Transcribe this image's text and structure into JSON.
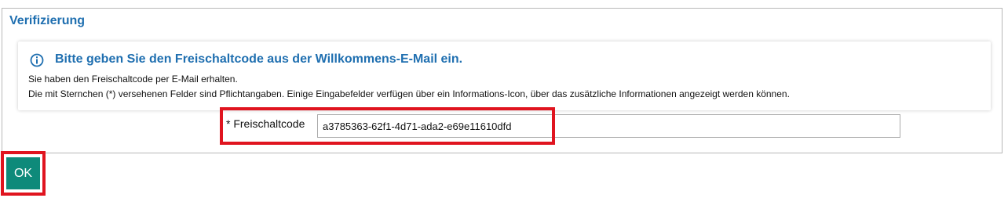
{
  "panel": {
    "title": "Verifizierung"
  },
  "info": {
    "icon": "info-circle-icon",
    "heading": "Bitte geben Sie den Freischaltcode aus der Willkommens-E-Mail ein.",
    "line1": "Sie haben den Freischaltcode per E-Mail erhalten.",
    "line2": "Die mit Sternchen (*) versehenen Felder sind Pflichtangaben. Einige Eingabefelder verfügen über ein Informations-Icon, über das zusätzliche Informationen angezeigt werden können."
  },
  "form": {
    "code_label": "* Freischaltcode",
    "code_value": "a3785363-62f1-4d71-ada2-e69e11610dfd"
  },
  "actions": {
    "ok_label": "OK"
  },
  "colors": {
    "accent_blue": "#1f6fb0",
    "ok_button": "#0e8a7a",
    "highlight_red": "#e0141f"
  }
}
